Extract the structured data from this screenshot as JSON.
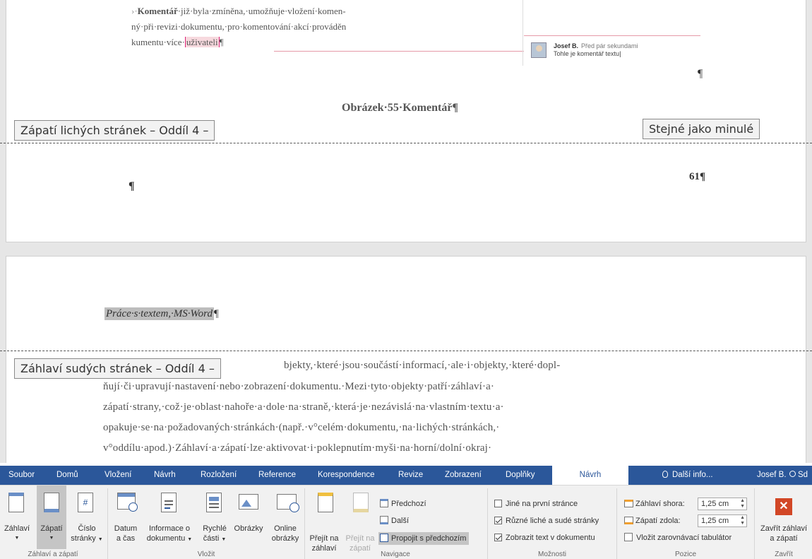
{
  "document": {
    "p1_line1_bold": "Komentář",
    "p1_line1_rest": "·již·byla·zmíněna,·umožňuje·vložení·komen-",
    "p1_line2": "ný·při·revizi·dokumentu,·pro·komentování·akcí·prováděn",
    "p1_line3_pre": "kumentu·více·",
    "p1_line3_hl": "uživateli",
    "pilcrow": "¶",
    "comment_author": "Josef B.",
    "comment_time": "Před pár sekundami",
    "comment_text": "Tohle je komentář textu",
    "caption": "Obrázek·55·Komentář¶",
    "footer_odd_label": "Zápatí lichých stránek – Oddíl 4 –",
    "same_as_previous": "Stejné jako minulé",
    "page_number": "61¶",
    "header_text": "Práce·s·textem,·MS·Word",
    "header_even_label": "Záhlaví sudých stránek – Oddíl 4 –",
    "body_line1": "bjekty,·které·jsou·součástí·informací,·ale·i·objekty,·které·dopl-",
    "body_line2": "ňují·či·upravují·nastavení·nebo·zobrazení·dokumentu.·Mezi·tyto·objekty·patří·záhlaví·a·",
    "body_line3": "zápatí·strany,·což·je·oblast·nahoře·a·dole·na·straně,·která·je·nezávislá·na·vlastním·textu·a·",
    "body_line4": "opakuje·se·na·požadovaných·stránkách·(např.·v°celém·dokumentu,·na·lichých·stránkách,·",
    "body_line5": "v°oddílu·apod.)·Záhlaví·a·zápatí·lze·aktivovat·i·poklepnutím·myši·na·horní/dolní·okraj·"
  },
  "tabs": {
    "soubor": "Soubor",
    "domu": "Domů",
    "vlozeni": "Vložení",
    "navrh": "Návrh",
    "rozlozeni": "Rozložení",
    "reference": "Reference",
    "korespondence": "Korespondence",
    "revize": "Revize",
    "zobrazeni": "Zobrazení",
    "doplnky": "Doplňky",
    "navrh_active": "Návrh",
    "dalsi_info": "Další info...",
    "user": "Josef B.",
    "share": "Sd"
  },
  "ribbon": {
    "zahlavi": "Záhlaví",
    "zapati": "Zápatí",
    "cislo_line1": "Číslo",
    "cislo_line2": "stránky",
    "group_hf": "Záhlaví a zápatí",
    "datum_line1": "Datum",
    "datum_line2": "a čas",
    "info_line1": "Informace o",
    "info_line2": "dokumentu",
    "rychle_line1": "Rychlé",
    "rychle_line2": "části",
    "obrazky": "Obrázky",
    "online_line1": "Online",
    "online_line2": "obrázky",
    "group_vlozit": "Vložit",
    "prejit_zahlavi_1": "Přejít na",
    "prejit_zahlavi_2": "záhlaví",
    "prejit_zapati_1": "Přejít na",
    "prejit_zapati_2": "zápatí",
    "predchozi": "Předchozí",
    "dalsi": "Další",
    "propojit": "Propojit s předchozím",
    "group_navigace": "Navigace",
    "opt_jine": "Jiné na první stránce",
    "opt_ruzne": "Různé liché a sudé stránky",
    "opt_zobrazit": "Zobrazit text v dokumentu",
    "group_moznosti": "Možnosti",
    "zahlavi_shora_label": "Záhlaví shora:",
    "zahlavi_shora_value": "1,25 cm",
    "zapati_zdola_label": "Zápatí zdola:",
    "zapati_zdola_value": "1,25 cm",
    "vlozit_tab": "Vložit zarovnávací tabulátor",
    "group_pozice": "Pozice",
    "zavrit_line1": "Zavřít záhlaví",
    "zavrit_line2": "a zápatí",
    "group_zavrit": "Zavřít"
  },
  "colors": {
    "tab_bar": "#2b579a",
    "close_button": "#d24726"
  }
}
